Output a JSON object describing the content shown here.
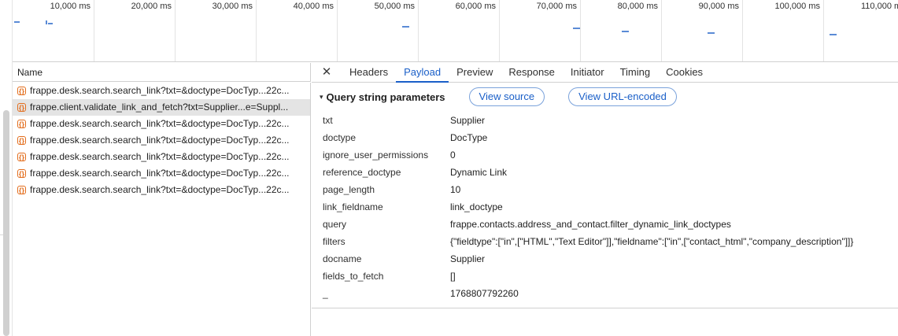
{
  "overview": {
    "labels": [
      "10,000 ms",
      "20,000 ms",
      "30,000 ms",
      "40,000 ms",
      "50,000 ms",
      "60,000 ms",
      "70,000 ms",
      "80,000 ms",
      "90,000 ms",
      "100,000 ms",
      "110,000 m"
    ]
  },
  "list": {
    "header": "Name",
    "rows": [
      "frappe.desk.search.search_link?txt=&doctype=DocTyp...22c...",
      "frappe.client.validate_link_and_fetch?txt=Supplier...e=Suppl...",
      "frappe.desk.search.search_link?txt=&doctype=DocTyp...22c...",
      "frappe.desk.search.search_link?txt=&doctype=DocTyp...22c...",
      "frappe.desk.search.search_link?txt=&doctype=DocTyp...22c...",
      "frappe.desk.search.search_link?txt=&doctype=DocTyp...22c...",
      "frappe.desk.search.search_link?txt=&doctype=DocTyp...22c..."
    ],
    "icon_glyph": "{}"
  },
  "tabs": {
    "close": "✕",
    "items": [
      "Headers",
      "Payload",
      "Preview",
      "Response",
      "Initiator",
      "Timing",
      "Cookies"
    ],
    "active": "Payload"
  },
  "payload": {
    "caret": "▾",
    "title": "Query string parameters",
    "view_source": "View source",
    "view_url_encoded": "View URL-encoded",
    "params": [
      {
        "key": "txt",
        "value": "Supplier"
      },
      {
        "key": "doctype",
        "value": "DocType"
      },
      {
        "key": "ignore_user_permissions",
        "value": "0"
      },
      {
        "key": "reference_doctype",
        "value": "Dynamic Link"
      },
      {
        "key": "page_length",
        "value": "10"
      },
      {
        "key": "link_fieldname",
        "value": "link_doctype"
      },
      {
        "key": "query",
        "value": "frappe.contacts.address_and_contact.filter_dynamic_link_doctypes"
      },
      {
        "key": "filters",
        "value": "{\"fieldtype\":[\"in\",[\"HTML\",\"Text Editor\"]],\"fieldname\":[\"in\",[\"contact_html\",\"company_description\"]]}"
      },
      {
        "key": "docname",
        "value": "Supplier"
      },
      {
        "key": "fields_to_fetch",
        "value": "[]"
      },
      {
        "key": "_",
        "value": "1768807792260"
      }
    ]
  },
  "colors": {
    "accent": "#1a5fc8",
    "xhr_icon": "#e36d1c",
    "selected_row": "#e4e4e4"
  }
}
